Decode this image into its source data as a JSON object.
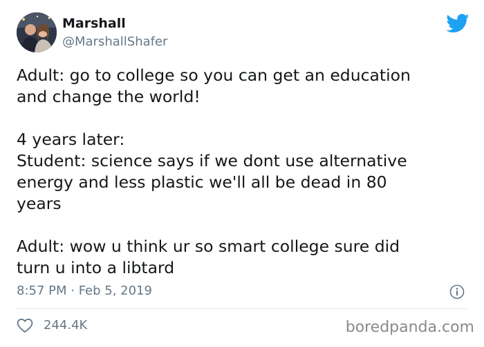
{
  "author": {
    "name": "Marshall",
    "handle": "@MarshallShafer"
  },
  "tweet": {
    "paragraphs": [
      {
        "lines": [
          "Adult: go to college so you can get an education",
          "and change the world!"
        ]
      },
      {
        "lines": [
          "4 years later:",
          "Student: science says if we dont use alternative",
          "energy and less plastic we'll all be dead in 80",
          "years"
        ]
      },
      {
        "lines": [
          "Adult: wow u think ur so smart college sure did",
          "turn u into a libtard"
        ]
      }
    ],
    "timestamp": "8:57 PM · Feb 5, 2019"
  },
  "actions": {
    "like_count": "244.4K"
  },
  "watermark": "boredpanda.com",
  "icons": {
    "brand": "twitter-bird-icon",
    "info": "info-icon",
    "like": "heart-icon"
  },
  "colors": {
    "twitter_blue": "#1da1f2",
    "text": "#14171a",
    "secondary": "#657786",
    "divider": "#e1e8ed"
  }
}
